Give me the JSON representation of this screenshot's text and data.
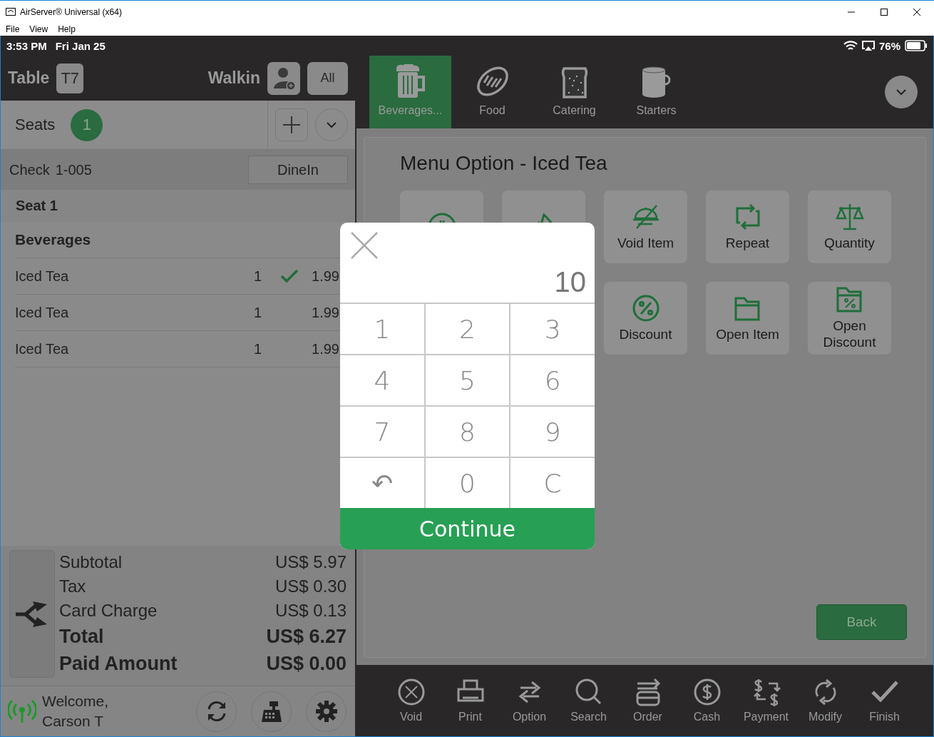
{
  "window": {
    "title": "AirServer® Universal (x64)",
    "menu": [
      "File",
      "View",
      "Help"
    ]
  },
  "status_bar": {
    "time": "3:53 PM",
    "date": "Fri Jan 25",
    "battery": "76%"
  },
  "order_panel": {
    "table_label": "Table",
    "table": "T7",
    "customer": "Walkin",
    "filter_button": "All",
    "seats_label": "Seats",
    "seat_count": "1",
    "check_label": "Check",
    "check_number": "1-005",
    "order_type": "DineIn",
    "seat": "Seat 1",
    "group": "Beverages",
    "items": [
      {
        "name": "Iced Tea",
        "qty": "1",
        "price": "1.99",
        "sent": true
      },
      {
        "name": "Iced Tea",
        "qty": "1",
        "price": "1.99",
        "sent": false
      },
      {
        "name": "Iced Tea",
        "qty": "1",
        "price": "1.99",
        "sent": false
      }
    ],
    "totals": [
      {
        "label": "Subtotal",
        "amount": "US$ 5.97",
        "emphasis": false
      },
      {
        "label": "Tax",
        "amount": "US$ 0.30",
        "emphasis": false
      },
      {
        "label": "Card Charge",
        "amount": "US$ 0.13",
        "emphasis": false
      },
      {
        "label": "Total",
        "amount": "US$ 6.27",
        "emphasis": true
      },
      {
        "label": "Paid Amount",
        "amount": "US$ 0.00",
        "emphasis": true
      }
    ],
    "welcome": [
      "Welcome,",
      "Carson T"
    ]
  },
  "categories": [
    {
      "label": "Beverages...",
      "selected": true
    },
    {
      "label": "Food",
      "selected": false
    },
    {
      "label": "Catering",
      "selected": false
    },
    {
      "label": "Starters",
      "selected": false
    }
  ],
  "menu_option": {
    "title": "Menu Option - Iced Tea",
    "options": [
      "Void Item",
      "Repeat",
      "Quantity",
      "Discount",
      "Open Item",
      "Open\nDiscount"
    ],
    "back": "Back"
  },
  "keypad": {
    "value": "10",
    "keys": [
      "1",
      "2",
      "3",
      "4",
      "5",
      "6",
      "7",
      "8",
      "9",
      "↶",
      "0",
      "C"
    ],
    "action": "Continue"
  },
  "toolbar": [
    "Void",
    "Print",
    "Option",
    "Search",
    "Order",
    "Cash",
    "Payment",
    "Modify",
    "Finish"
  ]
}
